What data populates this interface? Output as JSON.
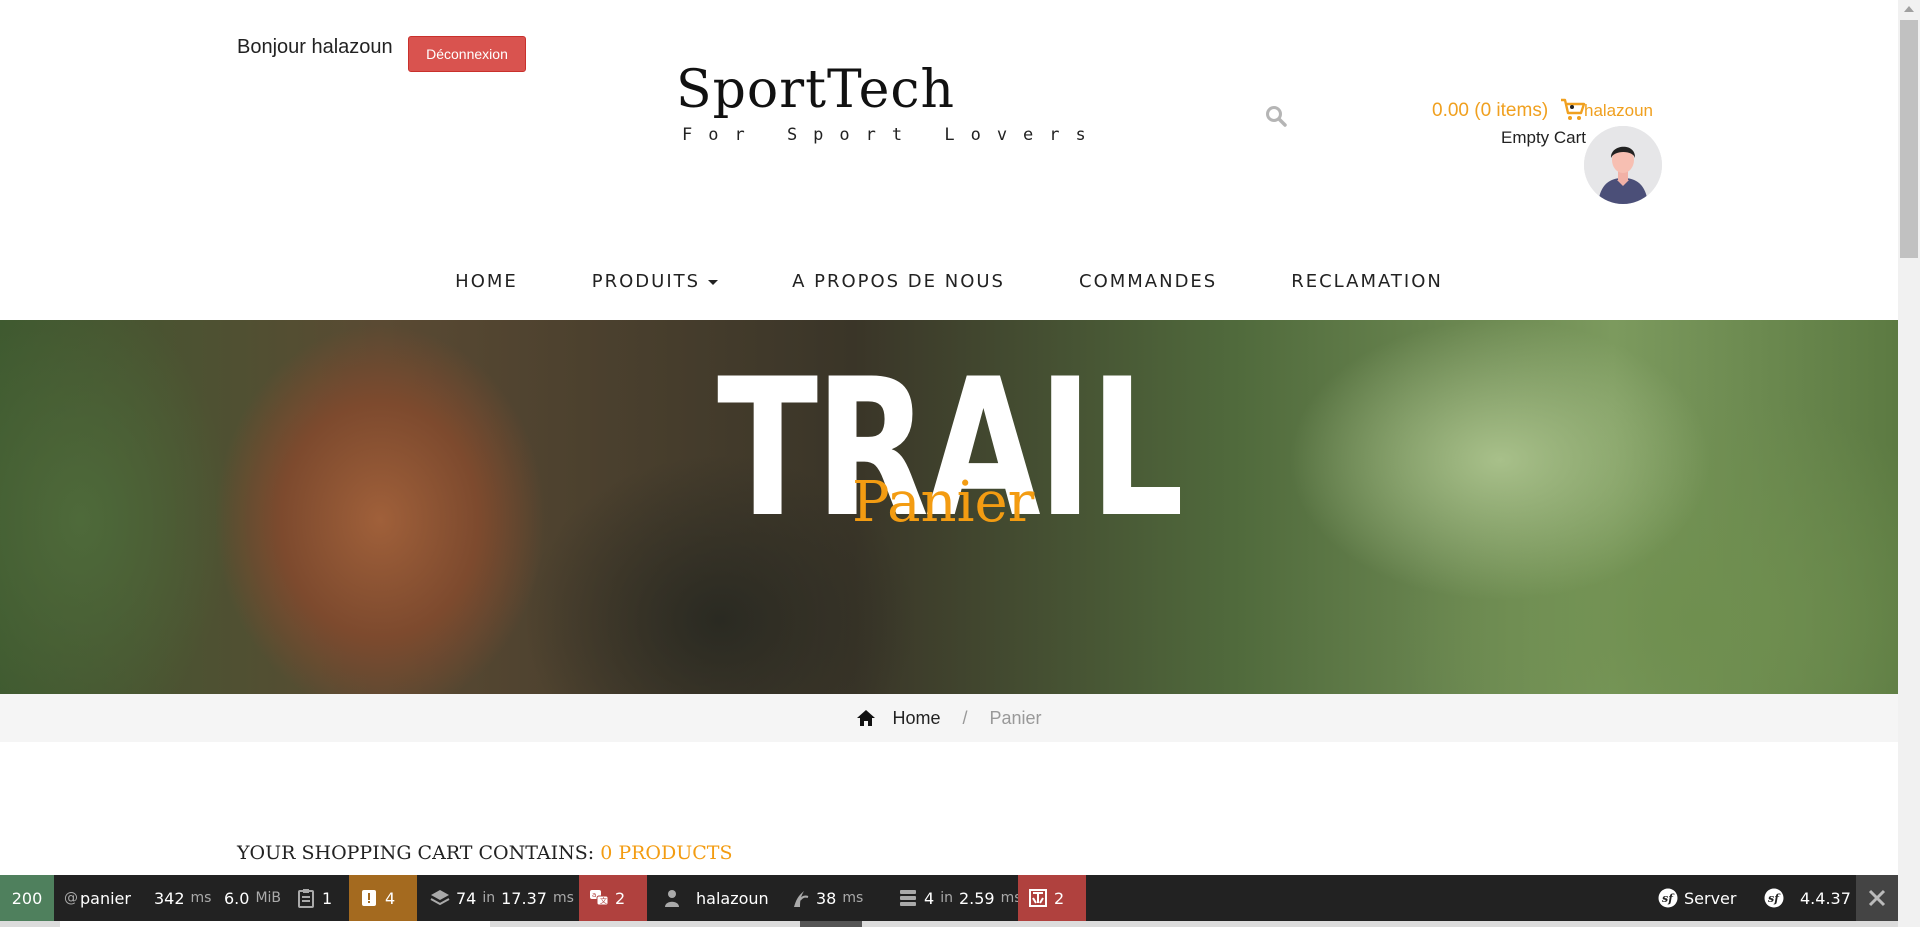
{
  "header": {
    "greeting": "Bonjour halazoun",
    "logout_label": "Déconnexion",
    "logo_title": "SportTech",
    "logo_subtitle": "For Sport Lovers",
    "cart_total": "0.00 (0 items)",
    "user_link": "halazoun",
    "empty_cart": "Empty Cart"
  },
  "nav": {
    "items": [
      {
        "label": "HOME"
      },
      {
        "label": "PRODUITS"
      },
      {
        "label": "A PROPOS DE NOUS"
      },
      {
        "label": "COMMANDES"
      },
      {
        "label": "RECLAMATION"
      }
    ]
  },
  "hero": {
    "image_text": "TRAIL",
    "title": "Panier"
  },
  "breadcrumb": {
    "home": "Home",
    "separator": "/",
    "current": "Panier"
  },
  "cart": {
    "heading": "YOUR SHOPPING CART CONTAINS:",
    "count": "0 PRODUCTS"
  },
  "toolbar": {
    "status": "200",
    "route_prefix": "@",
    "route": "panier",
    "time": "342",
    "time_unit": "ms",
    "memory": "6.0",
    "memory_unit": "MiB",
    "forms": "1",
    "logs": "4",
    "cache": "74",
    "cache_in": "in",
    "cache_time": "17.37",
    "cache_unit": "ms",
    "translation": "2",
    "user": "halazoun",
    "twig": "38",
    "twig_unit": "ms",
    "db": "4",
    "db_in": "in",
    "db_time": "2.59",
    "db_unit": "ms",
    "security": "2",
    "server": "Server",
    "version": "4.4.37"
  },
  "colors": {
    "accent": "#f39c12",
    "danger": "#d9534f",
    "toolbar_bg": "#222222",
    "status_ok": "#4f805d",
    "warning": "#a46a1f",
    "error": "#b0413e"
  }
}
